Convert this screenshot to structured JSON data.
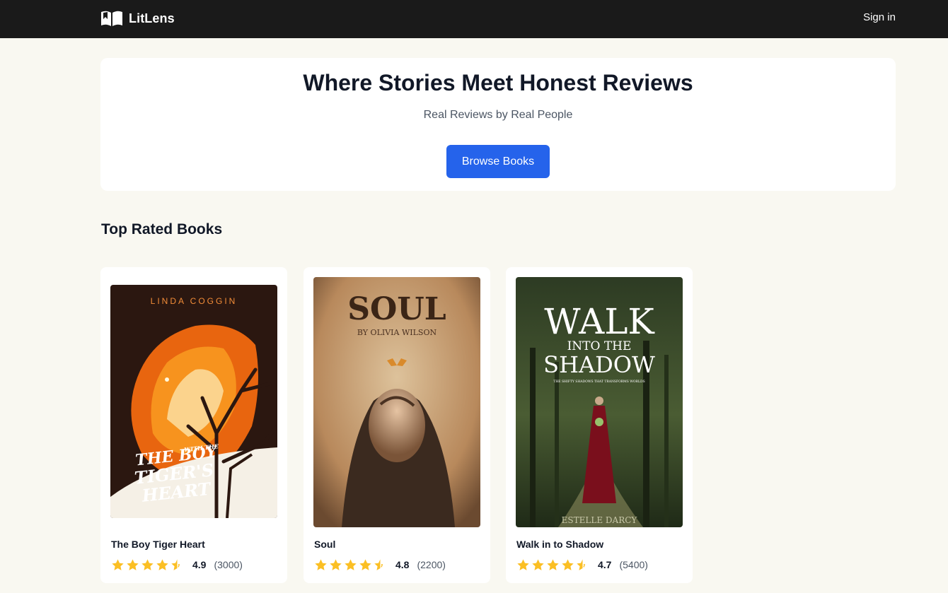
{
  "header": {
    "app_name": "LitLens",
    "logo_icon": "open-book-icon",
    "signin_label": "Sign in"
  },
  "hero": {
    "title": "Where Stories Meet Honest Reviews",
    "subtitle": "Real Reviews by Real People",
    "button_label": "Browse Books"
  },
  "top_rated": {
    "heading": "Top Rated Books",
    "books": [
      {
        "title": "The Boy Tiger Heart",
        "rating": "4.9",
        "count": "(3000)",
        "stars": 4.5,
        "cover": {
          "author": "LINDA COGGIN",
          "title_line1": "THE BOY",
          "title_small": "WITH THE",
          "title_line2": "TIGER'S",
          "title_line3": "HEART"
        }
      },
      {
        "title": "Soul",
        "rating": "4.8",
        "count": "(2200)",
        "stars": 4.5,
        "cover": {
          "title": "SOUL",
          "author": "BY OLIVIA WILSON"
        }
      },
      {
        "title": "Walk in to Shadow",
        "rating": "4.7",
        "count": "(5400)",
        "stars": 4.5,
        "cover": {
          "title_line1": "WALK",
          "title_line2": "INTO THE",
          "title_line3": "SHADOW",
          "tagline": "THE SHIFTY SHADOWS THAT TRANSFORMS WORLDS",
          "author": "ESTELLE DARCY"
        }
      }
    ]
  },
  "colors": {
    "header_bg": "#1a1a1a",
    "page_bg": "#f9f8f1",
    "accent": "#2563eb",
    "star": "#fbbf24"
  }
}
